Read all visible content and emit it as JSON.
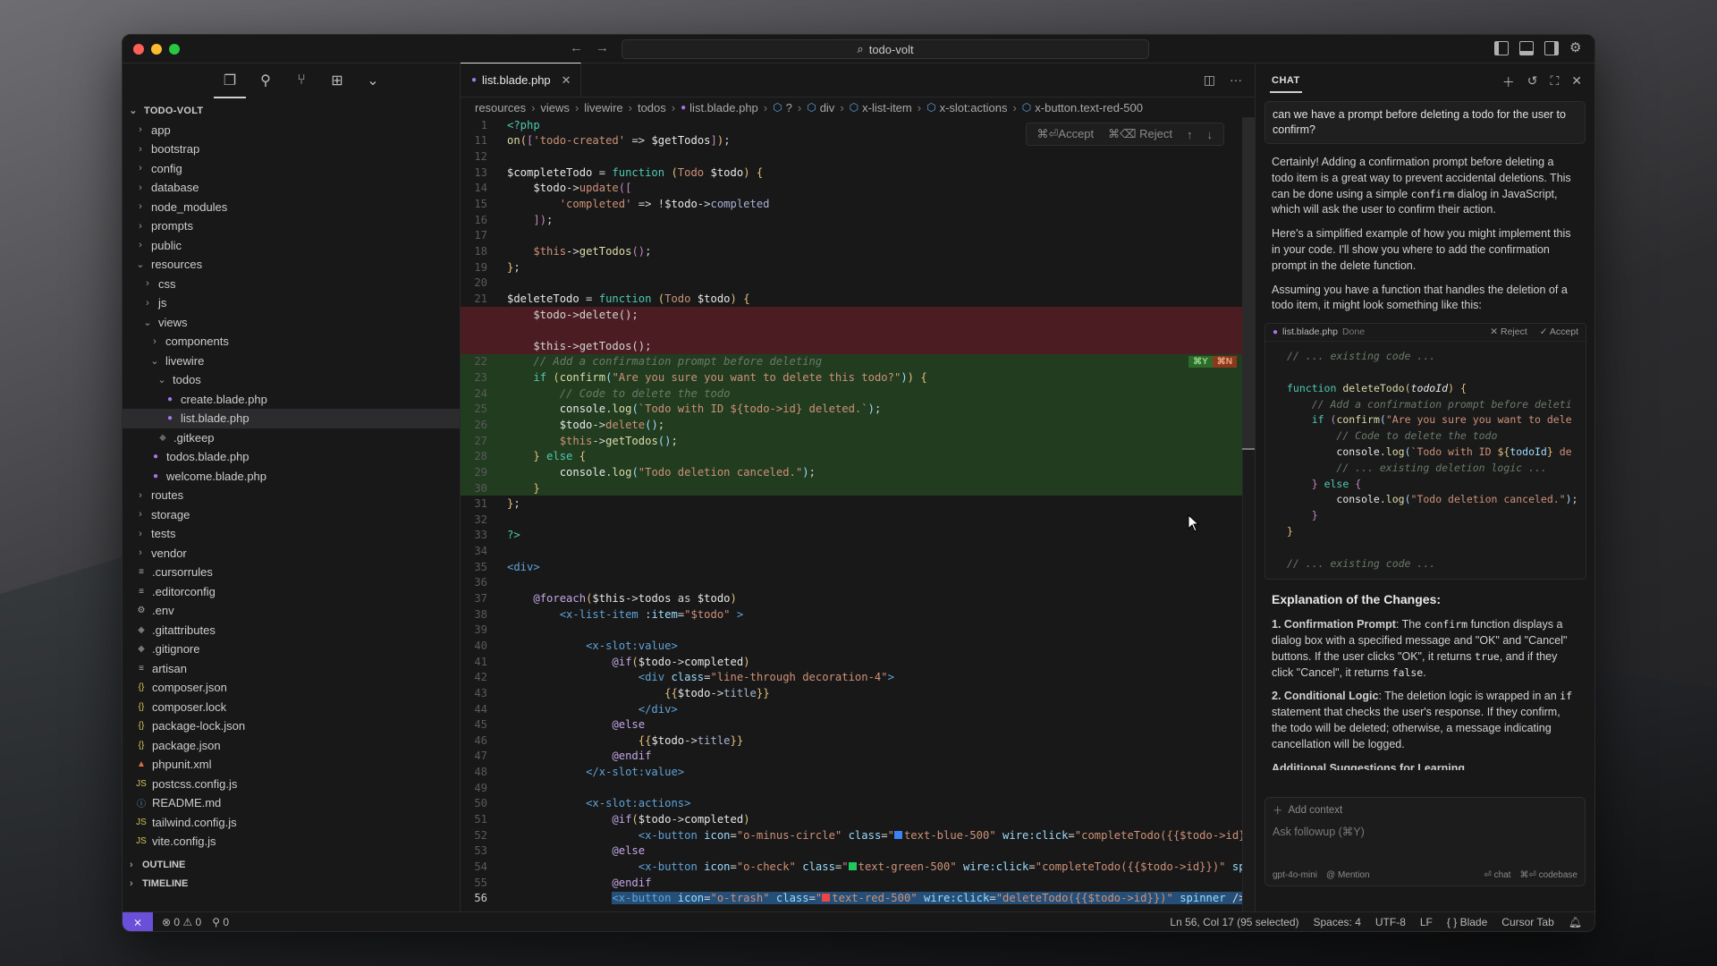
{
  "window": {
    "search_title": "todo-volt",
    "nav_back": "←",
    "nav_forward": "→"
  },
  "activity_bar": {
    "icons": [
      "files-icon",
      "search-icon",
      "source-control-icon",
      "extensions-icon",
      "chevron-down-icon"
    ]
  },
  "explorer": {
    "root": "TODO-VOLT",
    "items": [
      {
        "label": "app",
        "depth": 1,
        "type": "folder",
        "open": false
      },
      {
        "label": "bootstrap",
        "depth": 1,
        "type": "folder",
        "open": false
      },
      {
        "label": "config",
        "depth": 1,
        "type": "folder",
        "open": false
      },
      {
        "label": "database",
        "depth": 1,
        "type": "folder",
        "open": false
      },
      {
        "label": "node_modules",
        "depth": 1,
        "type": "folder",
        "open": false
      },
      {
        "label": "prompts",
        "depth": 1,
        "type": "folder",
        "open": false
      },
      {
        "label": "public",
        "depth": 1,
        "type": "folder",
        "open": false
      },
      {
        "label": "resources",
        "depth": 1,
        "type": "folder",
        "open": true
      },
      {
        "label": "css",
        "depth": 2,
        "type": "folder",
        "open": false
      },
      {
        "label": "js",
        "depth": 2,
        "type": "folder",
        "open": false
      },
      {
        "label": "views",
        "depth": 2,
        "type": "folder",
        "open": true
      },
      {
        "label": "components",
        "depth": 3,
        "type": "folder",
        "open": false
      },
      {
        "label": "livewire",
        "depth": 3,
        "type": "folder",
        "open": true
      },
      {
        "label": "todos",
        "depth": 4,
        "type": "folder",
        "open": true
      },
      {
        "label": "create.blade.php",
        "depth": 5,
        "type": "blade"
      },
      {
        "label": "list.blade.php",
        "depth": 5,
        "type": "blade",
        "selected": true
      },
      {
        "label": ".gitkeep",
        "depth": 4,
        "type": "gitkeep"
      },
      {
        "label": "todos.blade.php",
        "depth": 3,
        "type": "blade"
      },
      {
        "label": "welcome.blade.php",
        "depth": 3,
        "type": "blade"
      },
      {
        "label": "routes",
        "depth": 1,
        "type": "folder",
        "open": false
      },
      {
        "label": "storage",
        "depth": 1,
        "type": "folder",
        "open": false
      },
      {
        "label": "tests",
        "depth": 1,
        "type": "folder",
        "open": false
      },
      {
        "label": "vendor",
        "depth": 1,
        "type": "folder",
        "open": false
      },
      {
        "label": ".cursorrules",
        "depth": 1,
        "type": "text"
      },
      {
        "label": ".editorconfig",
        "depth": 1,
        "type": "text"
      },
      {
        "label": ".env",
        "depth": 1,
        "type": "gear"
      },
      {
        "label": ".gitattributes",
        "depth": 1,
        "type": "git"
      },
      {
        "label": ".gitignore",
        "depth": 1,
        "type": "git"
      },
      {
        "label": "artisan",
        "depth": 1,
        "type": "text"
      },
      {
        "label": "composer.json",
        "depth": 1,
        "type": "json"
      },
      {
        "label": "composer.lock",
        "depth": 1,
        "type": "json"
      },
      {
        "label": "package-lock.json",
        "depth": 1,
        "type": "json"
      },
      {
        "label": "package.json",
        "depth": 1,
        "type": "json"
      },
      {
        "label": "phpunit.xml",
        "depth": 1,
        "type": "xml"
      },
      {
        "label": "postcss.config.js",
        "depth": 1,
        "type": "js"
      },
      {
        "label": "README.md",
        "depth": 1,
        "type": "info"
      },
      {
        "label": "tailwind.config.js",
        "depth": 1,
        "type": "js"
      },
      {
        "label": "vite.config.js",
        "depth": 1,
        "type": "js"
      }
    ],
    "outline": "OUTLINE",
    "timeline": "TIMELINE"
  },
  "editor": {
    "tab": "list.blade.php",
    "breadcrumb": [
      "resources",
      "views",
      "livewire",
      "todos",
      "list.blade.php",
      "?",
      "div",
      "x-list-item",
      "x-slot:actions",
      "x-button.text-red-500"
    ],
    "diff_toolbar": {
      "accept": "⌘⏎Accept",
      "reject": "⌘⌫ Reject",
      "up": "↑",
      "down": "↓"
    },
    "diff_keys": {
      "yes": "⌘Y",
      "no": "⌘N"
    },
    "lines": [
      {
        "n": "1",
        "kind": "",
        "html": "<span class='c-kw'>&lt;?php</span>"
      },
      {
        "n": "11",
        "kind": "",
        "html": "<span class='c-fn'>on</span><span class='c-yel'>(</span><span class='c-pur'>[</span><span class='c-str'>'todo-created'</span> =&gt; <span class='c-var'>$getTodos</span><span class='c-pur'>]</span><span class='c-yel'>)</span>;"
      },
      {
        "n": "12",
        "kind": "",
        "html": ""
      },
      {
        "n": "13",
        "kind": "",
        "html": "<span class='c-var'>$completeTodo</span> = <span class='c-kw'>function</span> <span class='c-yel'>(</span><span class='c-str'>Todo</span> <span class='c-var'>$todo</span><span class='c-yel'>)</span> <span class='c-yel'>{</span>"
      },
      {
        "n": "14",
        "kind": "",
        "html": "    <span class='c-var'>$todo</span>-&gt;<span class='c-str'>update</span><span class='c-pur'>([</span>"
      },
      {
        "n": "15",
        "kind": "",
        "html": "        <span class='c-str'>'completed'</span> =&gt; !<span class='c-var'>$todo</span>-&gt;<span class='c-prop'>completed</span>"
      },
      {
        "n": "16",
        "kind": "",
        "html": "    <span class='c-pur'>])</span>;"
      },
      {
        "n": "17",
        "kind": "",
        "html": ""
      },
      {
        "n": "18",
        "kind": "",
        "html": "    <span class='c-str'>$this</span>-&gt;<span class='c-fn'>getTodos</span><span class='c-pur'>()</span>;"
      },
      {
        "n": "19",
        "kind": "",
        "html": "<span class='c-yel'>}</span>;"
      },
      {
        "n": "20",
        "kind": "",
        "html": ""
      },
      {
        "n": "21",
        "kind": "",
        "html": "<span class='c-var'>$deleteTodo</span> = <span class='c-kw'>function</span> <span class='c-yel'>(</span><span class='c-str'>Todo</span> <span class='c-var'>$todo</span><span class='c-yel'>)</span> <span class='c-yel'>{</span>"
      },
      {
        "n": "",
        "kind": "del",
        "html": "    $todo-&gt;delete();"
      },
      {
        "n": "",
        "kind": "del",
        "html": ""
      },
      {
        "n": "",
        "kind": "del",
        "html": "    $this-&gt;getTodos();"
      },
      {
        "n": "22",
        "kind": "add",
        "html": "    <span class='c-cmt'>// Add a confirmation prompt before deleting</span>"
      },
      {
        "n": "23",
        "kind": "add",
        "html": "    <span class='c-kw'>if</span> <span class='c-yel'>(</span><span class='c-fn'>confirm</span><span class='c-attr'>(</span><span class='c-str'>\"Are you sure you want to delete this todo?\"</span><span class='c-attr'>)</span><span class='c-yel'>)</span> <span class='c-yel'>{</span>"
      },
      {
        "n": "24",
        "kind": "add",
        "html": "        <span class='c-cmt'>// Code to delete the todo</span>"
      },
      {
        "n": "25",
        "kind": "add",
        "html": "        <span class='c-var'>console</span>.<span class='c-fn'>log</span><span class='c-attr'>(</span><span class='c-str'>`Todo with ID ${todo-&gt;id} deleted.`</span><span class='c-attr'>)</span>;"
      },
      {
        "n": "26",
        "kind": "add",
        "html": "        <span class='c-var'>$todo</span>-&gt;<span class='c-str'>delete</span><span class='c-attr'>()</span>;"
      },
      {
        "n": "27",
        "kind": "add",
        "html": "        <span class='c-str'>$this</span>-&gt;<span class='c-fn'>getTodos</span><span class='c-attr'>()</span>;"
      },
      {
        "n": "28",
        "kind": "add",
        "html": "    <span class='c-yel'>}</span> <span class='c-kw'>else</span> <span class='c-yel'>{</span>"
      },
      {
        "n": "29",
        "kind": "add",
        "html": "        <span class='c-var'>console</span>.<span class='c-fn'>log</span><span class='c-attr'>(</span><span class='c-str'>\"Todo deletion canceled.\"</span><span class='c-attr'>)</span>;"
      },
      {
        "n": "30",
        "kind": "add",
        "html": "    <span class='c-yel'>}</span>"
      },
      {
        "n": "31",
        "kind": "",
        "html": "<span class='c-yel'>}</span>;"
      },
      {
        "n": "32",
        "kind": "",
        "html": ""
      },
      {
        "n": "33",
        "kind": "",
        "html": "<span class='c-kw'>?&gt;</span>"
      },
      {
        "n": "34",
        "kind": "",
        "html": ""
      },
      {
        "n": "35",
        "kind": "",
        "html": "<span class='c-tag'>&lt;div&gt;</span>"
      },
      {
        "n": "36",
        "kind": "",
        "html": ""
      },
      {
        "n": "37",
        "kind": "",
        "html": "    <span class='c-blade'>@foreach</span><span class='c-yel'>(</span><span class='c-var'>$this</span>-&gt;<span class='c-var'>todos</span> as <span class='c-var'>$todo</span><span class='c-yel'>)</span>"
      },
      {
        "n": "38",
        "kind": "",
        "html": "        <span class='c-tag'>&lt;x-list-item</span> <span class='c-attr'>:item</span>=<span class='c-str'>\"$todo\"</span> <span class='c-tag'>&gt;</span>"
      },
      {
        "n": "39",
        "kind": "",
        "html": ""
      },
      {
        "n": "40",
        "kind": "",
        "html": "            <span class='c-tag'>&lt;x-slot:value&gt;</span>"
      },
      {
        "n": "41",
        "kind": "",
        "html": "                <span class='c-blade'>@if</span><span class='c-yel'>(</span><span class='c-var'>$todo</span>-&gt;<span class='c-var'>completed</span><span class='c-yel'>)</span>"
      },
      {
        "n": "42",
        "kind": "",
        "html": "                    <span class='c-tag'>&lt;div</span> <span class='c-attr'>class</span>=<span class='c-str'>\"line-through decoration-4\"</span><span class='c-tag'>&gt;</span>"
      },
      {
        "n": "43",
        "kind": "",
        "html": "                        <span class='c-yel'>{{</span><span class='c-var'>$todo</span>-&gt;<span class='c-prop'>title</span><span class='c-yel'>}}</span>"
      },
      {
        "n": "44",
        "kind": "",
        "html": "                    <span class='c-tag'>&lt;/div&gt;</span>"
      },
      {
        "n": "45",
        "kind": "",
        "html": "                <span class='c-blade'>@else</span>"
      },
      {
        "n": "46",
        "kind": "",
        "html": "                    <span class='c-yel'>{{</span><span class='c-var'>$todo</span>-&gt;<span class='c-prop'>title</span><span class='c-yel'>}}</span>"
      },
      {
        "n": "47",
        "kind": "",
        "html": "                <span class='c-blade'>@endif</span>"
      },
      {
        "n": "48",
        "kind": "",
        "html": "            <span class='c-tag'>&lt;/x-slot:value&gt;</span>"
      },
      {
        "n": "49",
        "kind": "",
        "html": ""
      },
      {
        "n": "50",
        "kind": "",
        "html": "            <span class='c-tag'>&lt;x-slot:actions&gt;</span>"
      },
      {
        "n": "51",
        "kind": "",
        "html": "                <span class='c-blade'>@if</span><span class='c-yel'>(</span><span class='c-var'>$todo</span>-&gt;<span class='c-var'>completed</span><span class='c-yel'>)</span>"
      },
      {
        "n": "52",
        "kind": "",
        "html": "                    <span class='c-tag'>&lt;x-button</span> <span class='c-attr'>icon</span>=<span class='c-str'>\"o-minus-circle\"</span> <span class='c-attr'>class</span>=<span class='c-str'>\"<span style='display:inline-block;width:9px;height:9px;background:#3b82f6;margin-right:2px'></span>text-blue-500\"</span> <span class='c-attr'>wire:click</span>=<span class='c-str'>\"completeTodo({{$todo-&gt;id}})\"</span>"
      },
      {
        "n": "53",
        "kind": "",
        "html": "                <span class='c-blade'>@else</span>"
      },
      {
        "n": "54",
        "kind": "",
        "html": "                    <span class='c-tag'>&lt;x-button</span> <span class='c-attr'>icon</span>=<span class='c-str'>\"o-check\"</span> <span class='c-attr'>class</span>=<span class='c-str'>\"<span style='display:inline-block;width:9px;height:9px;background:#22c55e;margin-right:2px'></span>text-green-500\"</span> <span class='c-attr'>wire:click</span>=<span class='c-str'>\"completeTodo({{$todo-&gt;id}})\"</span> <span class='c-attr'>spir</span>"
      },
      {
        "n": "55",
        "kind": "",
        "html": "                <span class='c-blade'>@endif</span>"
      },
      {
        "n": "56",
        "kind": "cur",
        "html": "                <span class='cursor-sel'><span class='c-tag'>&lt;x-button</span> <span class='c-attr'>icon</span>=<span class='c-str'>\"o-trash\"</span> <span class='c-attr'>class</span>=<span class='c-str'>\"<span style='display:inline-block;width:9px;height:9px;background:#ef4444;margin-right:2px'></span>text-red-500\"</span> <span class='c-attr'>wire:click</span>=<span class='c-str'>\"deleteTodo({{$todo-&gt;id}})\"</span> <span class='c-attr'>spinner</span> /&gt;</span>"
      }
    ]
  },
  "chat": {
    "title": "CHAT",
    "user_message": "can we have a prompt before deleting a todo for the user to confirm?",
    "para1_a": "Certainly! Adding a confirmation prompt before deleting a todo item is a great way to prevent accidental deletions. This can be done using a simple ",
    "para1_code": "confirm",
    "para1_b": " dialog in JavaScript, which will ask the user to confirm their action.",
    "para2": "Here's a simplified example of how you might implement this in your code. I'll show you where to add the confirmation prompt in the delete function.",
    "para3": "Assuming you have a function that handles the deletion of a todo item, it might look something like this:",
    "code_block": {
      "filename": "list.blade.php",
      "status": "Done",
      "reject": "✕ Reject",
      "accept": "✓ Accept",
      "lines_html": [
        "<span class='c-cmt'>// ... existing code ...</span>",
        "",
        "<span class='c-kw'>function</span> <span class='c-fn'>deleteTodo</span><span class='c-yel'>(</span><i class='c-var'>todoId</i><span class='c-yel'>)</span> <span class='c-yel'>{</span>",
        "    <span class='c-cmt'>// Add a confirmation prompt before deleti</span>",
        "    <span class='c-kw'>if</span> <span class='c-pur'>(</span><span class='c-fn'>confirm</span><span class='c-attr'>(</span><span class='c-str'>\"Are you sure you want to dele</span>",
        "        <span class='c-cmt'>// Code to delete the todo</span>",
        "        <span class='c-var'>console</span>.<span class='c-fn'>log</span><span class='c-attr'>(</span><span class='c-str'>`Todo with ID </span><span class='c-yel'>${</span><span class='c-attr'>todoId</span><span class='c-yel'>}</span><span class='c-str'> de</span>",
        "        <span class='c-cmt'>// ... existing deletion logic ...</span>",
        "    <span class='c-pur'>}</span> <span class='c-kw'>else</span> <span class='c-pur'>{</span>",
        "        <span class='c-var'>console</span>.<span class='c-fn'>log</span><span class='c-attr'>(</span><span class='c-str'>\"Todo deletion canceled.\"</span><span class='c-attr'>)</span>;",
        "    <span class='c-pur'>}</span>",
        "<span class='c-yel'>}</span>",
        "",
        "<span class='c-cmt'>// ... existing code ...</span>"
      ]
    },
    "explanation_heading": "Explanation of the Changes:",
    "point1_title": "1. Confirmation Prompt",
    "point1_a": ": The ",
    "point1_code": "confirm",
    "point1_b": " function displays a dialog box with a specified message and \"OK\" and \"Cancel\" buttons. If the user clicks \"OK\", it returns ",
    "point1_true": "true",
    "point1_c": ", and if they click \"Cancel\", it returns ",
    "point1_false": "false",
    "point1_d": ".",
    "point2_title": "2. Conditional Logic",
    "point2_a": ": The deletion logic is wrapped in an ",
    "point2_code": "if",
    "point2_b": " statement that checks the user's response. If they confirm, the todo will be deleted; otherwise, a message indicating cancellation will be logged.",
    "point3_partial": "Additional Suggestions for Learning",
    "input": {
      "add_context": "Add context",
      "placeholder": "Ask followup (⌘Y)",
      "model": "gpt-4o-mini",
      "mention": "@ Mention",
      "chat_btn": "⏎ chat",
      "codebase_btn": "⌘⏎ codebase"
    }
  },
  "statusbar": {
    "errors": "0",
    "warnings": "0",
    "ports": "0",
    "position": "Ln 56, Col 17 (95 selected)",
    "spaces": "Spaces: 4",
    "encoding": "UTF-8",
    "eol": "LF",
    "language": "Blade",
    "cursor_tab": "Cursor Tab"
  }
}
